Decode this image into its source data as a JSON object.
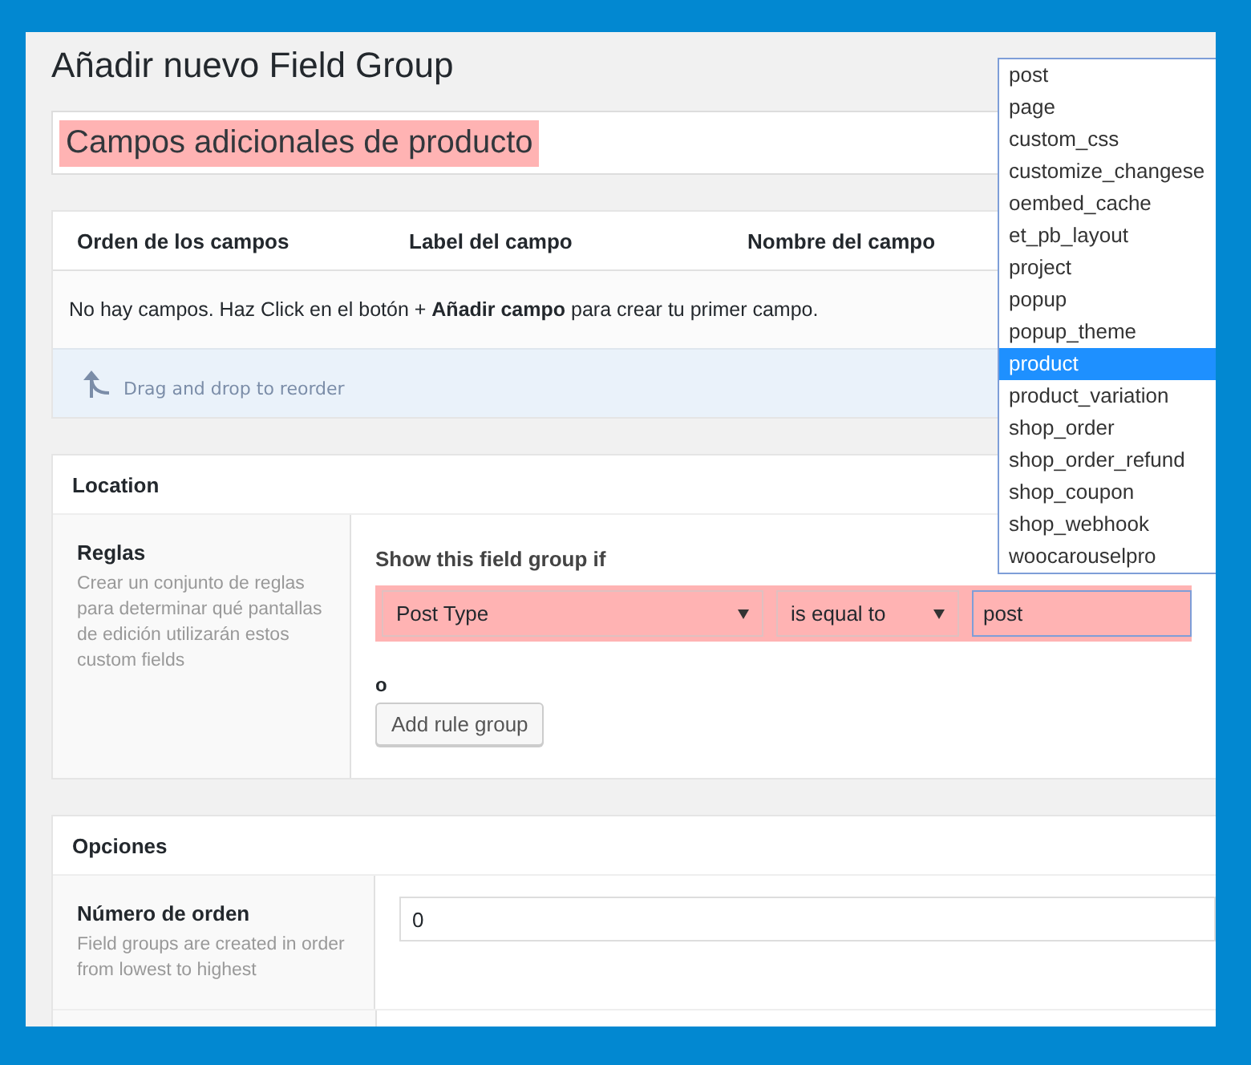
{
  "title": "Añadir nuevo Field Group",
  "title_field": {
    "value": "Campos adicionales de producto",
    "highlighted": true
  },
  "fields_table": {
    "columns": [
      "Orden de los campos",
      "Label del campo",
      "Nombre del campo"
    ],
    "empty_message": [
      {
        "text": "No hay campos. Haz Click en el botón + ",
        "bold": false
      },
      {
        "text": "Añadir campo",
        "bold": true
      },
      {
        "text": " para crear tu primer campo.",
        "bold": false
      }
    ],
    "hint": "Drag and drop to reorder"
  },
  "location": {
    "title": "Location",
    "rules_label": "Reglas",
    "rules_description": "Crear un conjunto de reglas para determinar qué pantallas de edición utilizarán estos custom fields",
    "condition_label": "Show this field group if",
    "rule": {
      "param": "Post Type",
      "operator": "is equal to",
      "value": "post",
      "highlighted": true
    },
    "or_label": "o",
    "add_button": "Add rule group"
  },
  "options": {
    "title": "Opciones",
    "rows": [
      {
        "label": "Número de orden",
        "description": "Field groups are created in order\nfrom lowest to highest",
        "value": "0"
      }
    ]
  },
  "dropdown": {
    "options": [
      {
        "label": "post",
        "selected": false
      },
      {
        "label": "page",
        "selected": false
      },
      {
        "label": "custom_css",
        "selected": false
      },
      {
        "label": "customize_changese",
        "selected": false
      },
      {
        "label": "oembed_cache",
        "selected": false
      },
      {
        "label": "et_pb_layout",
        "selected": false
      },
      {
        "label": "project",
        "selected": false
      },
      {
        "label": "popup",
        "selected": false
      },
      {
        "label": "popup_theme",
        "selected": false
      },
      {
        "label": "product",
        "selected": true
      },
      {
        "label": "product_variation",
        "selected": false
      },
      {
        "label": "shop_order",
        "selected": false
      },
      {
        "label": "shop_order_refund",
        "selected": false
      },
      {
        "label": "shop_coupon",
        "selected": false
      },
      {
        "label": "shop_webhook",
        "selected": false
      },
      {
        "label": "woocarouselpro",
        "selected": false
      }
    ]
  }
}
